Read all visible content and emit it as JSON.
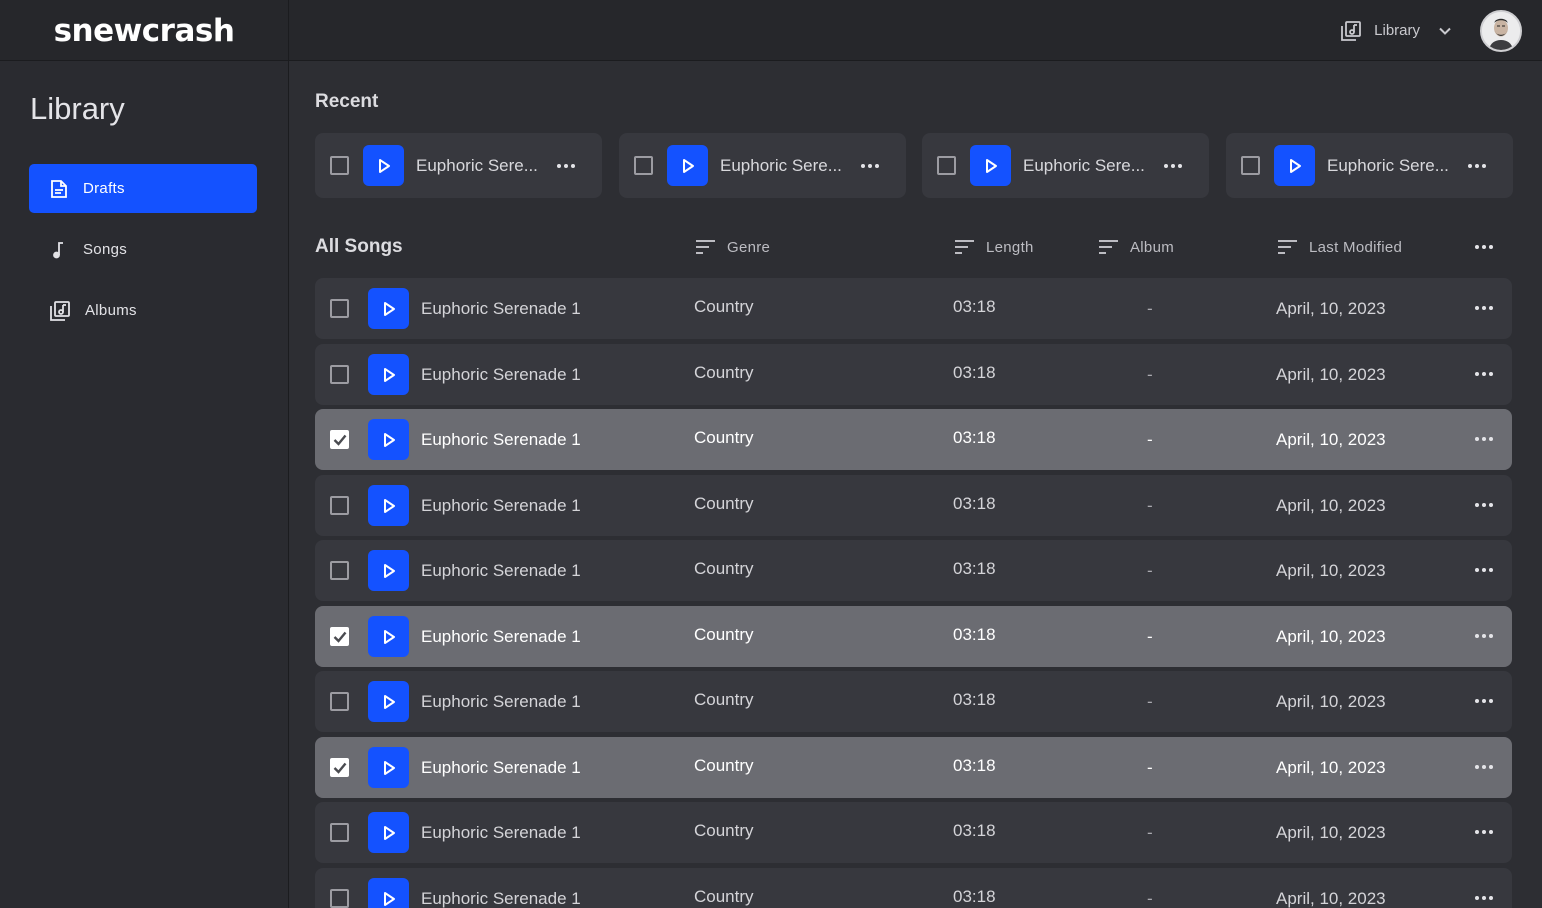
{
  "brand": {
    "name": "snewcrash"
  },
  "topbar": {
    "library_label": "Library",
    "library_icon": "library-music-icon",
    "chevron_icon": "chevron-down-icon"
  },
  "sidebar": {
    "title": "Library",
    "items": [
      {
        "label": "Drafts",
        "icon": "draft-doc-icon",
        "active": true
      },
      {
        "label": "Songs",
        "icon": "music-note-icon",
        "active": false
      },
      {
        "label": "Albums",
        "icon": "library-music-icon",
        "active": false
      }
    ]
  },
  "recent": {
    "title": "Recent",
    "cards": [
      {
        "name": "Euphoric Sere..."
      },
      {
        "name": "Euphoric Sere..."
      },
      {
        "name": "Euphoric Sere..."
      },
      {
        "name": "Euphoric Sere..."
      }
    ]
  },
  "all_songs": {
    "title": "All Songs",
    "columns": {
      "genre": "Genre",
      "length": "Length",
      "album": "Album",
      "modified": "Last Modified"
    },
    "rows": [
      {
        "name": "Euphoric Serenade 1",
        "genre": "Country",
        "length": "03:18",
        "album": "-",
        "modified": "April, 10, 2023",
        "selected": false
      },
      {
        "name": "Euphoric Serenade 1",
        "genre": "Country",
        "length": "03:18",
        "album": "-",
        "modified": "April, 10, 2023",
        "selected": false
      },
      {
        "name": "Euphoric Serenade 1",
        "genre": "Country",
        "length": "03:18",
        "album": "-",
        "modified": "April, 10, 2023",
        "selected": true
      },
      {
        "name": "Euphoric Serenade 1",
        "genre": "Country",
        "length": "03:18",
        "album": "-",
        "modified": "April, 10, 2023",
        "selected": false
      },
      {
        "name": "Euphoric Serenade 1",
        "genre": "Country",
        "length": "03:18",
        "album": "-",
        "modified": "April, 10, 2023",
        "selected": false
      },
      {
        "name": "Euphoric Serenade 1",
        "genre": "Country",
        "length": "03:18",
        "album": "-",
        "modified": "April, 10, 2023",
        "selected": true
      },
      {
        "name": "Euphoric Serenade 1",
        "genre": "Country",
        "length": "03:18",
        "album": "-",
        "modified": "April, 10, 2023",
        "selected": false
      },
      {
        "name": "Euphoric Serenade 1",
        "genre": "Country",
        "length": "03:18",
        "album": "-",
        "modified": "April, 10, 2023",
        "selected": true
      },
      {
        "name": "Euphoric Serenade 1",
        "genre": "Country",
        "length": "03:18",
        "album": "-",
        "modified": "April, 10, 2023",
        "selected": false
      },
      {
        "name": "Euphoric Serenade 1",
        "genre": "Country",
        "length": "03:18",
        "album": "-",
        "modified": "April, 10, 2023",
        "selected": false
      }
    ]
  },
  "colors": {
    "accent": "#1452ff",
    "background": "#2d2e33",
    "card": "#37383e",
    "selected_row": "#6b6c72"
  }
}
